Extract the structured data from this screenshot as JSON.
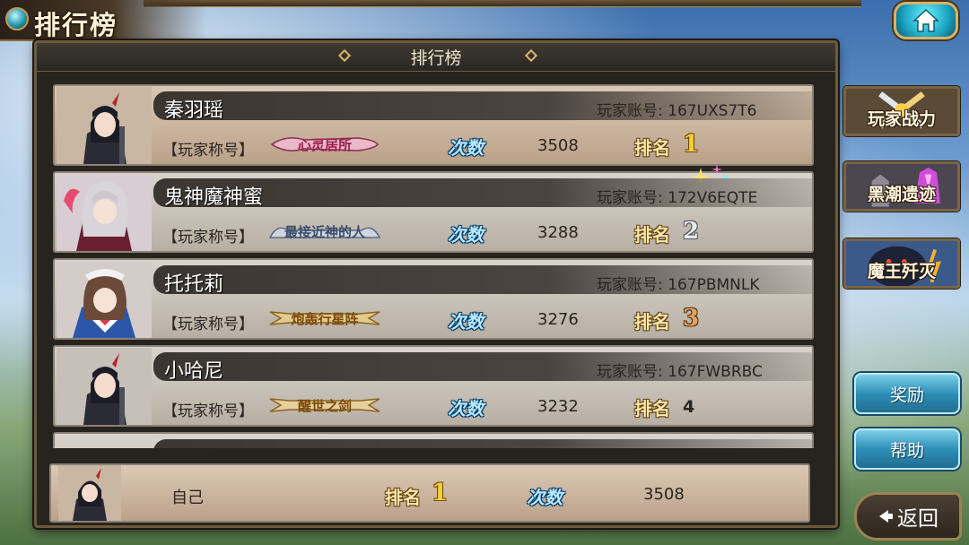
{
  "header": {
    "title": "排行榜"
  },
  "panel": {
    "title": "排行榜"
  },
  "labels": {
    "account": "玩家账号:",
    "player_title": "【玩家称号】",
    "times": "次数",
    "rank": "排名"
  },
  "rows": [
    {
      "name": "秦羽瑶",
      "account": "167UXS7T6",
      "badge": "心灵居所",
      "times": "3508",
      "rank": "1"
    },
    {
      "name": "鬼神魔神蜜",
      "account": "172V6EQTE",
      "badge": "最接近神的人",
      "times": "3288",
      "rank": "2"
    },
    {
      "name": "托托莉",
      "account": "167PBMNLK",
      "badge": "炮轰行星阵",
      "times": "3276",
      "rank": "3"
    },
    {
      "name": "小哈尼",
      "account": "167FWBRBC",
      "badge": "醒世之剑",
      "times": "3232",
      "rank": "4"
    }
  ],
  "self": {
    "name": "自己",
    "rank_label": "排名",
    "rank": "1",
    "times_label": "次数",
    "times": "3508"
  },
  "sidebar": {
    "modes": [
      {
        "label": "玩家战力",
        "icon": "crossed-swords-icon"
      },
      {
        "label": "黑潮遗迹",
        "icon": "crystal-ruins-icon"
      },
      {
        "label": "魔王歼灭",
        "icon": "demon-king-icon"
      }
    ],
    "reward_label": "奖励",
    "help_label": "帮助",
    "back_label": "返回"
  },
  "colors": {
    "gold": "#f4cf3a",
    "teal_button": "#1ca6c3",
    "blue_button": "#2f8fb8",
    "panel": "#27241f"
  }
}
